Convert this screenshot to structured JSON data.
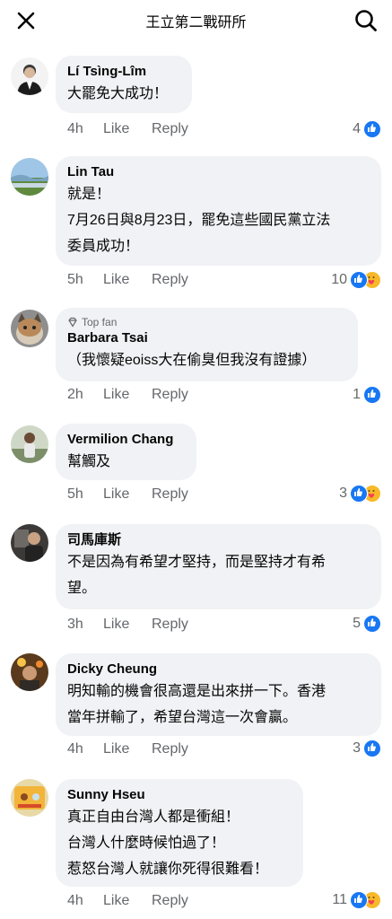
{
  "header": {
    "title": "王立第二戰研所"
  },
  "actions": {
    "like": "Like",
    "reply": "Reply"
  },
  "colors": {
    "like_blue": "#1877f2",
    "care_yellow": "#f7b928",
    "bubble_bg": "#f0f2f5",
    "meta_gray": "#65676b"
  },
  "comments": [
    {
      "author": "Lí Tsìng-Lîm",
      "lines": "大罷免大成功！",
      "time": "4h",
      "reactions": "4",
      "reaction_types": [
        "like"
      ]
    },
    {
      "author": "Lin Tau",
      "lines": "就是！\n7月26日與8月23日，罷免這些國民黨立法\n委員成功！",
      "time": "5h",
      "reactions": "10",
      "reaction_types": [
        "like",
        "care"
      ]
    },
    {
      "badge": "Top fan",
      "author": "Barbara Tsai",
      "lines": "（我懷疑eoiss大在偷臭但我沒有證據）",
      "time": "2h",
      "reactions": "1",
      "reaction_types": [
        "like"
      ]
    },
    {
      "author": "Vermilion Chang",
      "lines": "幫觸及",
      "time": "5h",
      "reactions": "3",
      "reaction_types": [
        "like",
        "care"
      ]
    },
    {
      "author": "司馬庫斯",
      "lines": "不是因為有希望才堅持，而是堅持才有希\n望。",
      "time": "3h",
      "reactions": "5",
      "reaction_types": [
        "like"
      ]
    },
    {
      "author": "Dicky Cheung",
      "lines": "明知輸的機會很高還是出來拼一下。香港\n當年拼輸了，希望台灣這一次會贏。",
      "time": "4h",
      "reactions": "3",
      "reaction_types": [
        "like"
      ]
    },
    {
      "author": "Sunny Hseu",
      "lines": "真正自由台灣人都是衝組！\n台灣人什麼時候怕過了！\n惹怒台灣人就讓你死得很難看！",
      "time": "4h",
      "reactions": "11",
      "reaction_types": [
        "like",
        "care"
      ]
    }
  ]
}
